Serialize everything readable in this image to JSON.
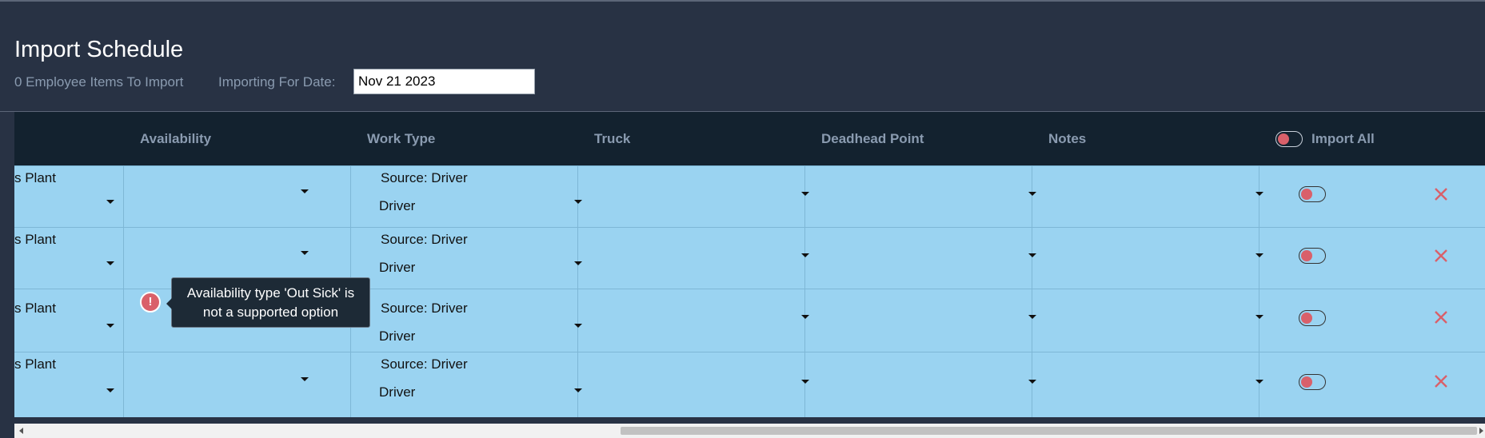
{
  "header": {
    "title": "Import Schedule",
    "items_to_import": "0 Employee Items To Import",
    "date_label": "Importing For Date:",
    "date_value": "Nov 21 2023"
  },
  "table": {
    "columns": {
      "availability": "Availability",
      "work_type": "Work Type",
      "truck": "Truck",
      "deadhead_point": "Deadhead Point",
      "notes": "Notes",
      "import_all": "Import All"
    },
    "rows": [
      {
        "plant": "s Plant",
        "source": "Source: Driver",
        "work_type": "Driver",
        "import_on": false
      },
      {
        "plant": "s Plant",
        "source": "Source: Driver",
        "work_type": "Driver",
        "import_on": false
      },
      {
        "plant": "s Plant",
        "source": "Source: Driver",
        "work_type": "Driver",
        "import_on": false
      },
      {
        "plant": "s Plant",
        "source": "Source: Driver",
        "work_type": "Driver",
        "import_on": false
      }
    ],
    "error_tooltip": {
      "line1": "Availability type 'Out Sick' is",
      "line2": "not a supported option",
      "icon_glyph": "!"
    }
  },
  "icons": {
    "delete": "close-icon",
    "error": "alert-icon",
    "dropdown": "chevron-down-icon"
  },
  "colors": {
    "background": "#283244",
    "header_row": "#13222f",
    "row_bg": "#9ad3f1",
    "accent_red": "#d9606a"
  }
}
